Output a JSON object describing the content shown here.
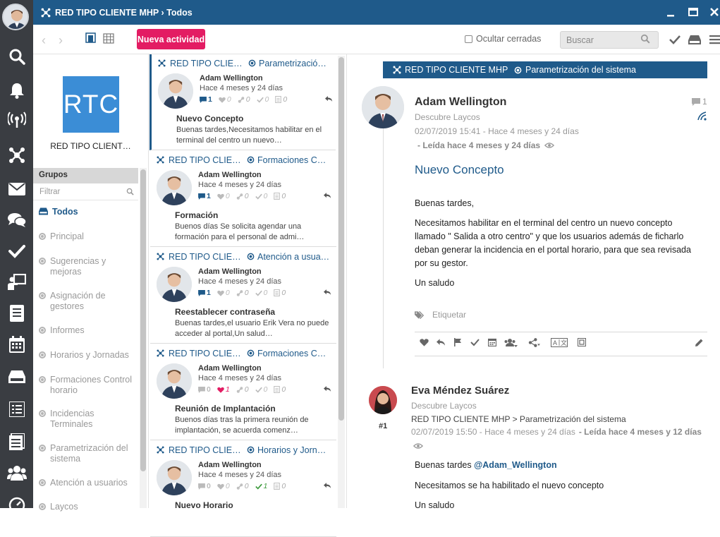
{
  "window": {
    "title": "RED TIPO CLIENTE MHP › Todos"
  },
  "toolbar": {
    "new_activity": "Nueva actividad",
    "hide_closed": "Ocultar cerradas",
    "search_placeholder": "Buscar"
  },
  "left": {
    "logo_text": "RTC",
    "org_name": "RED TIPO CLIENT…",
    "groups_header": "Grupos",
    "filter_placeholder": "Filtrar",
    "groups": [
      {
        "label": "Todos",
        "selected": true
      },
      {
        "label": "Principal"
      },
      {
        "label": "Sugerencias y mejoras"
      },
      {
        "label": "Asignación de gestores"
      },
      {
        "label": "Informes"
      },
      {
        "label": "Horarios y Jornadas"
      },
      {
        "label": "Formaciones Control horario"
      },
      {
        "label": "Incidencias Terminales"
      },
      {
        "label": "Parametrización del sistema"
      },
      {
        "label": "Atención a usuarios"
      },
      {
        "label": "Laycos"
      }
    ]
  },
  "feed": {
    "cards": [
      {
        "network": "RED TIPO CLIE…",
        "group": "Parametrizació…",
        "author": "Adam Wellington",
        "time": "Hace 4 meses y 24 días",
        "comments": "1",
        "likes": "0",
        "links": "0",
        "checks": "0",
        "docs": "0",
        "title": "Nuevo Concepto",
        "excerpt": "Buenas tardes,Necesitamos habilitar en el terminal del centro un nuevo…"
      },
      {
        "network": "RED TIPO CLIE…",
        "group": "Formaciones C…",
        "author": "Adam Wellington",
        "time": "Hace 4 meses y 24 días",
        "comments": "1",
        "likes": "0",
        "links": "0",
        "checks": "0",
        "docs": "0",
        "title": "Formación",
        "excerpt": "Buenos días Se solicita agendar una formación para el personal de admi…"
      },
      {
        "network": "RED TIPO CLIE…",
        "group": "Atención a usua…",
        "author": "Adam Wellington",
        "time": "Hace 4 meses y 24 días",
        "comments": "1",
        "likes": "0",
        "links": "0",
        "checks": "0",
        "docs": "0",
        "title": "Reestablecer contraseña",
        "excerpt": "Buenas tardes,el usuario Erik Vera no puede acceder al portal,Un salud…"
      },
      {
        "network": "RED TIPO CLIE…",
        "group": "Formaciones C…",
        "author": "Adam Wellington",
        "time": "Hace 4 meses y 24 días",
        "comments": "0",
        "likes": "1",
        "links": "0",
        "checks": "0",
        "docs": "0",
        "title": "Reunión de Implantación",
        "excerpt": "Buenos días tras la primera reunión de implantación, se acuerda comenz…"
      },
      {
        "network": "RED TIPO CLIE…",
        "group": "Horarios y Jorn…",
        "author": "Adam Wellington",
        "time": "Hace 4 meses y 24 días",
        "comments": "0",
        "likes": "0",
        "links": "0",
        "checks": "1",
        "docs": "0",
        "title": "Nuevo Horario",
        "excerpt": ""
      }
    ]
  },
  "detail": {
    "network": "RED TIPO CLIENTE MHP",
    "group": "Parametrización del sistema",
    "author": "Adam Wellington",
    "org": "Descubre Laycos",
    "timestamp": "02/07/2019 15:41 - Hace 4 meses y 24 días",
    "read": "- Leída hace 4 meses y 24 días",
    "comment_count": "1",
    "title": "Nuevo Concepto",
    "body": [
      "Buenas tardes,",
      "Necesitamos habilitar en el terminal del centro un nuevo concepto llamado \" Salida a otro centro\" y que los usuarios además de ficharlo deban generar la incidencia en el portal horario, para que sea revisada por su gestor.",
      "Un saludo"
    ],
    "tag_label": "Etiquetar",
    "reply": {
      "author": "Eva Méndez Suárez",
      "org": "Descubre Laycos",
      "path": "RED TIPO CLIENTE MHP > Parametrización del sistema",
      "timestamp": "02/07/2019 15:50 - Hace 4 meses y 24 días",
      "read": "- Leída hace 4 meses y 12 días",
      "number": "#1",
      "greeting": "Buenas tardes",
      "mention": "@Adam_Wellington",
      "line2": "Necesitamos se ha habilitado el nuevo concepto",
      "line3": "Un saludo"
    }
  },
  "colors": {
    "brand": "#1f5a8a",
    "accent": "#e31c63",
    "rail": "#3a3d42"
  }
}
